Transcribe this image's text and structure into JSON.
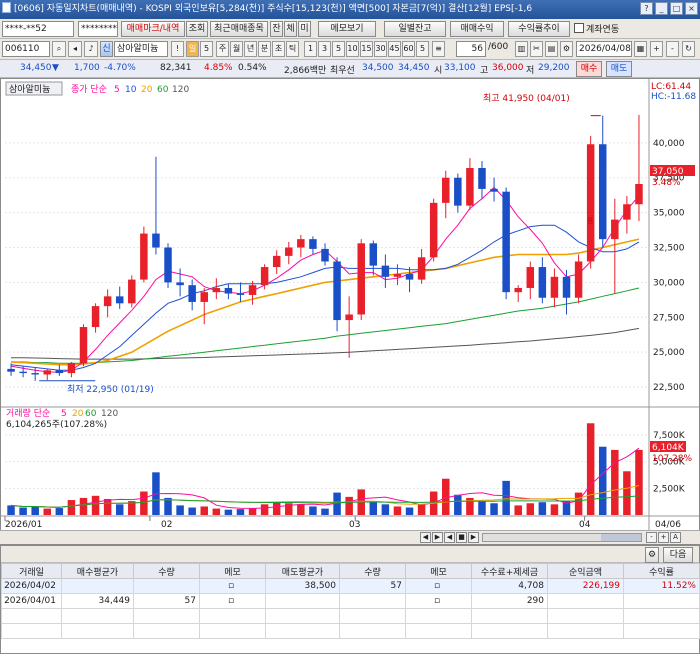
{
  "window": {
    "title": "[0606] 자동일지차트(매매내역) - KOSPI 외국인보유[5,284(천)] 주식수[15,123(천)] 액면[500] 자본금[7(억)] 결산[12월] EPS[-1,6",
    "buttons": [
      "?",
      "_",
      "□",
      "×"
    ]
  },
  "toolbar1": {
    "account": "****-**52",
    "password": "********",
    "tab_trade_history": "매매마크/내역",
    "query": "조회",
    "recent": "최근매매종목",
    "seg": [
      "잔",
      "체",
      "미"
    ],
    "memo": "메모보기",
    "daily_balance": "일별잔고",
    "trade_profit": "매매수익",
    "profit_trend": "수익률추이",
    "account_link": "계좌연동"
  },
  "toolbar2": {
    "code": "006110",
    "credit": "신",
    "name": "삼아알미늄",
    "bang": "!",
    "bong_num": "5",
    "periods": [
      "주",
      "월",
      "년",
      "분",
      "초",
      "틱"
    ],
    "intervals": [
      "1",
      "3",
      "5",
      "10",
      "15",
      "30",
      "45",
      "60",
      "5"
    ],
    "count": "56",
    "total": "/600",
    "date": "2026/04/08"
  },
  "quote": {
    "price": "34,450",
    "change": "1,700",
    "change_pct": "-4.70%",
    "volume": "82,341",
    "vol_pct": "4.85%",
    "turnover": "0.54%",
    "amount": "2,866백만",
    "best_label": "최우선",
    "ask": "34,500",
    "bid": "34,450",
    "high_label": "시",
    "open": "33,100",
    "high_label2": "고",
    "high": "36,000",
    "low_label": "저",
    "low": "29,200",
    "buy": "매수",
    "sell": "매도"
  },
  "chart": {
    "stock_tag": "삼아알미늄",
    "ma_title": "종가 단순",
    "ma_labels": [
      "5",
      "10",
      "20",
      "60",
      "120"
    ],
    "lc": "LC:61.44",
    "hc": "HC:-11.68",
    "price_label": "37,050",
    "price_pct": "3.48%",
    "high_annot": "최고 41,950 (04/01)",
    "low_annot": "최저 22,950 (01/19)",
    "vol_title": "거래량 단순",
    "vol_readout": "6,104,265주(107.28%)",
    "vol_tag": "6,104K",
    "vol_pct_tag": "107.28%",
    "xlabels": [
      "2026/01",
      "02",
      "03",
      "04",
      "04/06"
    ],
    "buy_marker": "B",
    "sell_marker": "S"
  },
  "colors": {
    "up": "#e8202a",
    "down": "#1a4fc7",
    "ma5": "#ff0aa0",
    "ma10": "#2050d8",
    "ma20": "#f0a000",
    "ma60": "#1aa030",
    "ma120": "#555555"
  },
  "chart_data": {
    "type": "candlestick",
    "price_axis": [
      40000,
      37500,
      35000,
      32500,
      30000,
      27500,
      25000,
      22500
    ],
    "price_range": [
      21500,
      43000
    ],
    "volume_axis": [
      "7,500K",
      "5,000K",
      "2,500K"
    ],
    "volume_range": [
      0,
      9000
    ],
    "candles": [
      [
        23800,
        24200,
        23300,
        23600,
        900
      ],
      [
        23600,
        24000,
        23200,
        23500,
        700
      ],
      [
        23500,
        23900,
        22950,
        23400,
        800
      ],
      [
        23400,
        23800,
        23000,
        23700,
        600
      ],
      [
        23700,
        24100,
        23300,
        23500,
        650
      ],
      [
        23500,
        24300,
        23200,
        24200,
        1400
      ],
      [
        24200,
        27000,
        24000,
        26800,
        1600
      ],
      [
        26800,
        28500,
        26400,
        28300,
        1800
      ],
      [
        28300,
        29500,
        27500,
        29000,
        1500
      ],
      [
        29000,
        29700,
        28100,
        28500,
        1000
      ],
      [
        28500,
        30500,
        28200,
        30200,
        1300
      ],
      [
        30200,
        34000,
        30000,
        33500,
        2200
      ],
      [
        33500,
        39000,
        32000,
        32500,
        4000
      ],
      [
        32500,
        32800,
        29600,
        30000,
        1600
      ],
      [
        30000,
        31000,
        29000,
        29800,
        900
      ],
      [
        29800,
        30200,
        28000,
        28600,
        700
      ],
      [
        28600,
        29600,
        27000,
        29300,
        800
      ],
      [
        29300,
        30300,
        28800,
        29600,
        600
      ],
      [
        29600,
        29900,
        28800,
        29200,
        500
      ],
      [
        29200,
        30000,
        28600,
        29100,
        550
      ],
      [
        29100,
        30100,
        28400,
        29800,
        650
      ],
      [
        29800,
        31300,
        29500,
        31100,
        1000
      ],
      [
        31100,
        32300,
        30600,
        31900,
        1200
      ],
      [
        31900,
        32900,
        31300,
        32500,
        1100
      ],
      [
        32500,
        33400,
        31800,
        33100,
        1000
      ],
      [
        33100,
        33300,
        32000,
        32400,
        800
      ],
      [
        32400,
        32800,
        31200,
        31500,
        600
      ],
      [
        31500,
        31800,
        26500,
        27300,
        2100
      ],
      [
        27300,
        29000,
        24600,
        27700,
        1700
      ],
      [
        27700,
        33100,
        27300,
        32800,
        2400
      ],
      [
        32800,
        33000,
        30500,
        31200,
        1200
      ],
      [
        31200,
        32000,
        29600,
        30400,
        1000
      ],
      [
        30400,
        31300,
        29800,
        30600,
        800
      ],
      [
        30600,
        31100,
        29300,
        30200,
        700
      ],
      [
        30200,
        32400,
        29900,
        31800,
        1000
      ],
      [
        31800,
        36000,
        31500,
        35700,
        2200
      ],
      [
        35700,
        38000,
        34600,
        37500,
        3400
      ],
      [
        37500,
        37800,
        35000,
        35500,
        1900
      ],
      [
        35500,
        38900,
        35200,
        38200,
        1600
      ],
      [
        38200,
        38700,
        36000,
        36700,
        1300
      ],
      [
        36700,
        37500,
        35800,
        36500,
        1100
      ],
      [
        36500,
        36800,
        28800,
        29300,
        3200
      ],
      [
        29300,
        29800,
        28600,
        29600,
        900
      ],
      [
        29600,
        31500,
        28800,
        31100,
        1100
      ],
      [
        31100,
        31800,
        28500,
        28900,
        1200
      ],
      [
        28900,
        31000,
        28200,
        30400,
        1000
      ],
      [
        30400,
        30900,
        27700,
        28900,
        1300
      ],
      [
        28900,
        32000,
        28500,
        31500,
        2100
      ],
      [
        31500,
        40500,
        31000,
        39900,
        8600
      ],
      [
        39900,
        41950,
        32500,
        33100,
        6400
      ],
      [
        33100,
        36000,
        29200,
        34500,
        6100
      ],
      [
        34500,
        36200,
        33500,
        35600,
        4100
      ],
      [
        35600,
        42000,
        34400,
        37050,
        6104
      ]
    ],
    "ma5": [
      24000,
      23850,
      23700,
      23600,
      23550,
      23700,
      24300,
      25200,
      26200,
      27100,
      28000,
      29000,
      30200,
      30800,
      30600,
      30400,
      29700,
      29400,
      29300,
      29200,
      29400,
      29800,
      30300,
      30900,
      31600,
      32000,
      32300,
      31500,
      30600,
      30700,
      30700,
      30200,
      30300,
      30600,
      30900,
      31900,
      33100,
      34100,
      35300,
      36000,
      36800,
      35900,
      34700,
      33800,
      32800,
      31400,
      30400,
      30600,
      31500,
      32500,
      33900,
      35200,
      36200
    ],
    "ma10": [
      24100,
      24000,
      23900,
      23800,
      23700,
      23700,
      23900,
      24200,
      24800,
      25400,
      26200,
      27000,
      27800,
      28500,
      28800,
      29200,
      29400,
      29700,
      29900,
      29900,
      29900,
      29900,
      30000,
      30200,
      30400,
      30700,
      31000,
      31100,
      31000,
      31000,
      31000,
      31000,
      31000,
      30900,
      30900,
      30900,
      31000,
      31300,
      31800,
      32300,
      32900,
      33400,
      33700,
      34000,
      34100,
      34100,
      33600,
      32900,
      32500,
      32200,
      32200,
      32400,
      32900
    ],
    "ma20": [
      24300,
      24250,
      24200,
      24150,
      24100,
      24100,
      24150,
      24250,
      24400,
      24700,
      25000,
      25500,
      26000,
      26500,
      26900,
      27300,
      27700,
      28000,
      28300,
      28600,
      28800,
      29000,
      29200,
      29400,
      29600,
      29800,
      30000,
      30100,
      30200,
      30300,
      30400,
      30500,
      30600,
      30700,
      30800,
      30900,
      31000,
      31200,
      31400,
      31600,
      31800,
      31900,
      32000,
      32000,
      32000,
      32000,
      32000,
      32100,
      32300,
      32500,
      32700,
      32900,
      33100
    ],
    "ma60": [
      24300,
      24300,
      24250,
      24250,
      24200,
      24200,
      24200,
      24250,
      24300,
      24350,
      24400,
      24500,
      24600,
      24700,
      24800,
      24900,
      25000,
      25100,
      25200,
      25300,
      25400,
      25500,
      25600,
      25700,
      25800,
      25900,
      26000,
      26150,
      26250,
      26350,
      26450,
      26550,
      26650,
      26750,
      26850,
      26950,
      27050,
      27200,
      27350,
      27500,
      27650,
      27800,
      27950,
      28050,
      28150,
      28300,
      28450,
      28600,
      28800,
      29000,
      29200,
      29400,
      29600
    ],
    "ma120": [
      24600,
      24600,
      24580,
      24560,
      24540,
      24520,
      24500,
      24500,
      24500,
      24500,
      24500,
      24520,
      24540,
      24560,
      24580,
      24600,
      24620,
      24650,
      24680,
      24710,
      24740,
      24770,
      24800,
      24830,
      24860,
      24890,
      24920,
      24960,
      25000,
      25050,
      25100,
      25150,
      25200,
      25250,
      25300,
      25350,
      25400,
      25450,
      25500,
      25560,
      25620,
      25680,
      25740,
      25800,
      25880,
      25960,
      26040,
      26120,
      26200,
      26300,
      26400,
      26550,
      26700
    ]
  },
  "scroll": {
    "icons": [
      "◀",
      "▶",
      "◀",
      "■",
      "▶",
      "-",
      "+",
      "A"
    ]
  },
  "panel": {
    "icon_label": "다음",
    "headers": [
      "거래일",
      "매수평균가",
      "수량",
      "메모",
      "매도평균가",
      "수량",
      "메모",
      "수수료+제세금",
      "순익금액",
      "수익률"
    ],
    "rows": [
      {
        "date": "2026/04/02",
        "buy_avg": "",
        "buy_qty": "",
        "sell_avg": "38,500",
        "sell_qty": "57",
        "fee": "4,708",
        "profit": "226,199",
        "rate": "11.52%"
      },
      {
        "date": "2026/04/01",
        "buy_avg": "34,449",
        "buy_qty": "57",
        "sell_avg": "",
        "sell_qty": "",
        "fee": "290",
        "profit": "",
        "rate": ""
      }
    ]
  }
}
